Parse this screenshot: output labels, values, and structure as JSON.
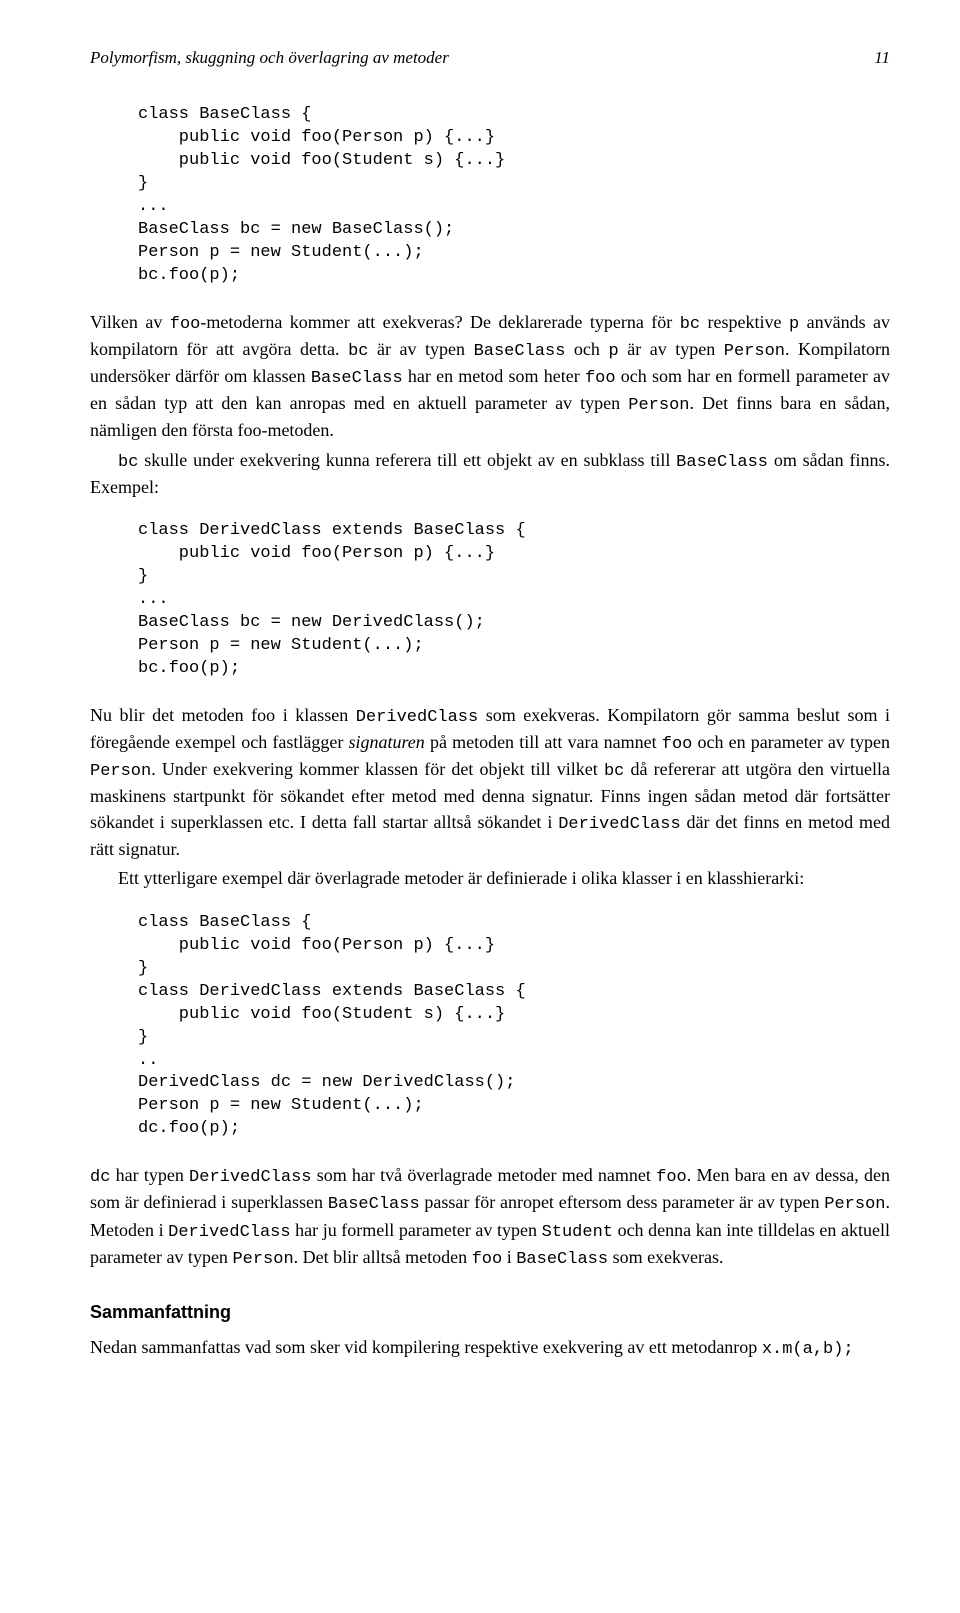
{
  "header": {
    "title": "Polymorfism, skuggning och överlagring av metoder",
    "page": "11"
  },
  "code1": "class BaseClass {\n    public void foo(Person p) {...}\n    public void foo(Student s) {...}\n}\n...\nBaseClass bc = new BaseClass();\nPerson p = new Student(...);\nbc.foo(p);",
  "para1": "Vilken av foo-metoderna kommer att exekveras? De deklarerade typerna för bc respektive p används av kompilatorn för att avgöra detta. bc är av typen BaseClass och p är av typen Person. Kompilatorn undersöker därför om klassen BaseClass har en metod som heter foo och som har en formell parameter av en sådan typ att den kan anropas med en aktuell parameter av typen Person. Det finns bara en sådan, nämligen den första foo-metoden.",
  "para2": "bc skulle under exekvering kunna referera till ett objekt av en subklass till BaseClass om sådan finns. Exempel:",
  "code2": "class DerivedClass extends BaseClass {\n    public void foo(Person p) {...}\n}\n...\nBaseClass bc = new DerivedClass();\nPerson p = new Student(...);\nbc.foo(p);",
  "para3": "Nu blir det metoden foo i klassen DerivedClass som exekveras. Kompilatorn gör samma beslut som i föregående exempel och fastlägger signaturen på metoden till att vara namnet foo och en parameter av typen Person. Under exekvering kommer klassen för det objekt till vilket bc då refererar att utgöra den virtuella maskinens startpunkt för sökandet efter metod med denna signatur. Finns ingen sådan metod där fortsätter sökandet i superklassen etc. I detta fall startar alltså sökandet i DerivedClass där det finns en metod med rätt signatur.",
  "para4": "Ett ytterligare exempel där överlagrade metoder är definierade i olika klasser i en klasshierarki:",
  "code3": "class BaseClass {\n    public void foo(Person p) {...}\n}\nclass DerivedClass extends BaseClass {\n    public void foo(Student s) {...}\n}\n..\nDerivedClass dc = new DerivedClass();\nPerson p = new Student(...);\ndc.foo(p);",
  "para5": "dc har typen DerivedClass som har två överlagrade metoder med namnet foo. Men bara en av dessa, den som är definierad i superklassen BaseClass passar för anropet eftersom dess parameter är av typen Person. Metoden i DerivedClass har ju formell parameter av typen Student och denna kan inte tilldelas en aktuell parameter av typen Person. Det blir alltså metoden foo i BaseClass som exekveras.",
  "summary_heading": "Sammanfattning",
  "para6": "Nedan sammanfattas vad som sker vid kompilering respektive exekvering av ett metodanrop x.m(a,b);"
}
